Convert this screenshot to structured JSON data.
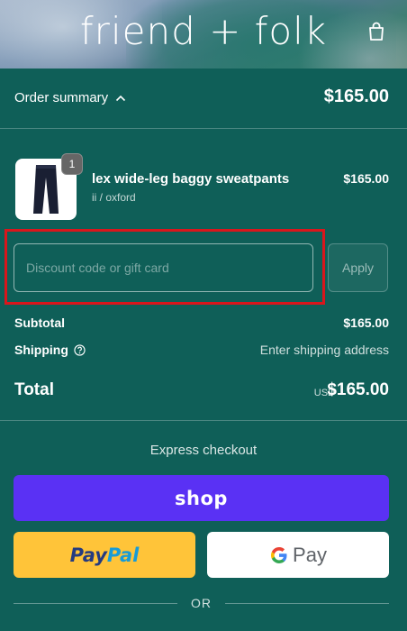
{
  "header": {
    "brand": "friend + folk",
    "cart_icon": "shopping-bag-icon"
  },
  "summary": {
    "toggle_label": "Order summary",
    "toggle_icon": "chevron-up-icon",
    "total": "$165.00"
  },
  "line_item": {
    "name": "lex wide-leg baggy sweatpants",
    "variant": "ii / oxford",
    "price": "$165.00",
    "quantity": "1",
    "image_icon": "pants-icon"
  },
  "discount": {
    "placeholder": "Discount code or gift card",
    "value": "",
    "apply_label": "Apply"
  },
  "totals": {
    "subtotal_label": "Subtotal",
    "subtotal_value": "$165.00",
    "shipping_label": "Shipping",
    "shipping_help_icon": "question-circle-icon",
    "shipping_value": "Enter shipping address",
    "total_label": "Total",
    "total_currency": "USD",
    "total_value": "$165.00"
  },
  "express": {
    "title": "Express checkout",
    "shop_label": "shop",
    "paypal_pay": "Pay",
    "paypal_pal": "Pal",
    "gpay_label": "Pay",
    "separator": "OR"
  },
  "colors": {
    "background": "#0f5f58",
    "highlight": "#d9161c",
    "shop_pay": "#5a31f4",
    "paypal": "#ffc439",
    "paypal_dark": "#253b80",
    "paypal_light": "#179bd7"
  }
}
